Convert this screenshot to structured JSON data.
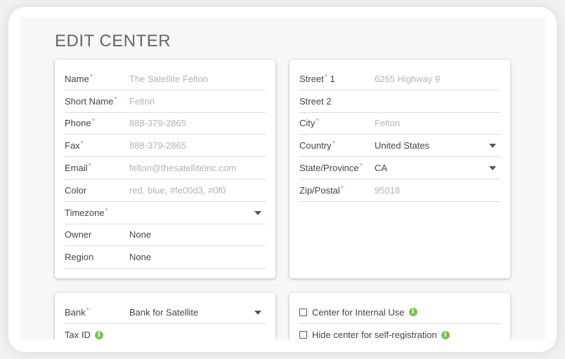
{
  "page": {
    "title": "EDIT CENTER"
  },
  "info_card": {
    "fields": [
      {
        "label": "Name",
        "required": true,
        "value": "The Satellite Felton",
        "placeholder": true
      },
      {
        "label": "Short Name",
        "required": true,
        "value": "Felton",
        "placeholder": true
      },
      {
        "label": "Phone",
        "required": true,
        "value": "888-379-2865",
        "placeholder": true
      },
      {
        "label": "Fax",
        "required": true,
        "value": "888-379-2865",
        "placeholder": true
      },
      {
        "label": "Email",
        "required": true,
        "value": "felton@thesatelliteinc.com",
        "placeholder": true
      },
      {
        "label": "Color",
        "required": false,
        "value": "red, blue, #fe00d3, #0f0",
        "placeholder": true
      },
      {
        "label": "Timezone",
        "required": true,
        "value": "",
        "placeholder": false,
        "dropdown": true
      },
      {
        "label": "Owner",
        "required": false,
        "value": "None",
        "placeholder": false
      },
      {
        "label": "Region",
        "required": false,
        "value": "None",
        "placeholder": false
      }
    ]
  },
  "address_card": {
    "street1": {
      "label": "Street",
      "suffix": " 1",
      "required": true,
      "value": "6265 Highway 9"
    },
    "street2": {
      "label": "Street 2",
      "required": false,
      "value": ""
    },
    "city": {
      "label": "City",
      "required": true,
      "value": "Felton"
    },
    "country": {
      "label": "Country",
      "required": true,
      "value": "United States"
    },
    "state": {
      "label": "State/Province",
      "required": true,
      "value": "CA"
    },
    "zip": {
      "label": "Zip/Postal",
      "required": true,
      "value": "95018"
    }
  },
  "bank_card": {
    "bank": {
      "label": "Bank",
      "required": true,
      "value": "Bank for Satellite"
    },
    "tax": {
      "label": "Tax ID"
    }
  },
  "options_card": {
    "internal": {
      "label": "Center for Internal Use",
      "checked": false
    },
    "hide": {
      "label": "Hide center for self-registration",
      "checked": false
    }
  },
  "icons": {
    "info": "info-icon",
    "dropdown": "chevron-down-icon",
    "checkbox": "checkbox-icon"
  },
  "colors": {
    "accent": "#7cc254",
    "title": "#666666",
    "placeholder": "#b3b3b3",
    "divider": "#dcdcdc"
  },
  "glyphs": {
    "required": "*",
    "info": "i"
  }
}
